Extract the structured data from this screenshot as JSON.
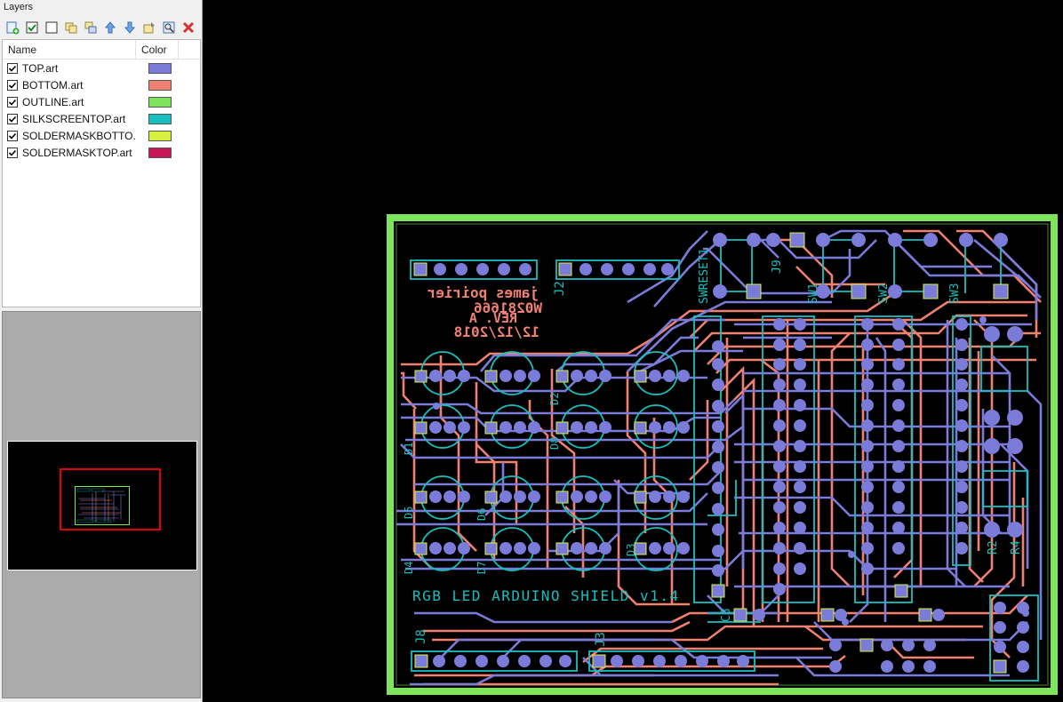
{
  "panel": {
    "title": "Layers"
  },
  "toolbar": {
    "buttons": [
      {
        "icon": "add-layer-icon"
      },
      {
        "icon": "check-all-icon"
      },
      {
        "icon": "uncheck-all-icon"
      },
      {
        "icon": "copy-layer-icon"
      },
      {
        "icon": "merge-layer-icon"
      },
      {
        "icon": "arrow-up-icon"
      },
      {
        "icon": "arrow-down-icon"
      },
      {
        "icon": "layer-properties-icon"
      },
      {
        "icon": "zoom-layer-icon"
      },
      {
        "icon": "delete-icon"
      }
    ]
  },
  "table": {
    "headers": {
      "name": "Name",
      "color": "Color"
    },
    "layers": [
      {
        "name": "TOP.art",
        "color": "#7b7bd9",
        "checked": true
      },
      {
        "name": "BOTTOM.art",
        "color": "#f08070",
        "checked": true
      },
      {
        "name": "OUTLINE.art",
        "color": "#7ee45c",
        "checked": true
      },
      {
        "name": "SILKSCREENTOP.art",
        "color": "#17bfbf",
        "checked": true
      },
      {
        "name": "SOLDERMASKBOTTO...",
        "color": "#d8f040",
        "checked": true
      },
      {
        "name": "SOLDERMASKTOP.art",
        "color": "#c8165a",
        "checked": true
      }
    ]
  },
  "pcb": {
    "silk_text": {
      "name": "james poirier",
      "id": "W0281666",
      "rev": "REV. A",
      "date": "12/12/2018",
      "title": "RGB LED ARDUINO SHIELD v1.4",
      "j2": "J2",
      "j8": "J8",
      "j9": "J9",
      "j3": "J3",
      "sw_reset": "SWRESET1",
      "sw1": "SW1",
      "sw2": "SW2",
      "sw3": "SW3",
      "r2": "R2",
      "r4": "R4",
      "c3": "C3",
      "d_labels": [
        "D1",
        "D2",
        "D3",
        "D4",
        "D5",
        "D6",
        "D7",
        "D8"
      ]
    }
  }
}
